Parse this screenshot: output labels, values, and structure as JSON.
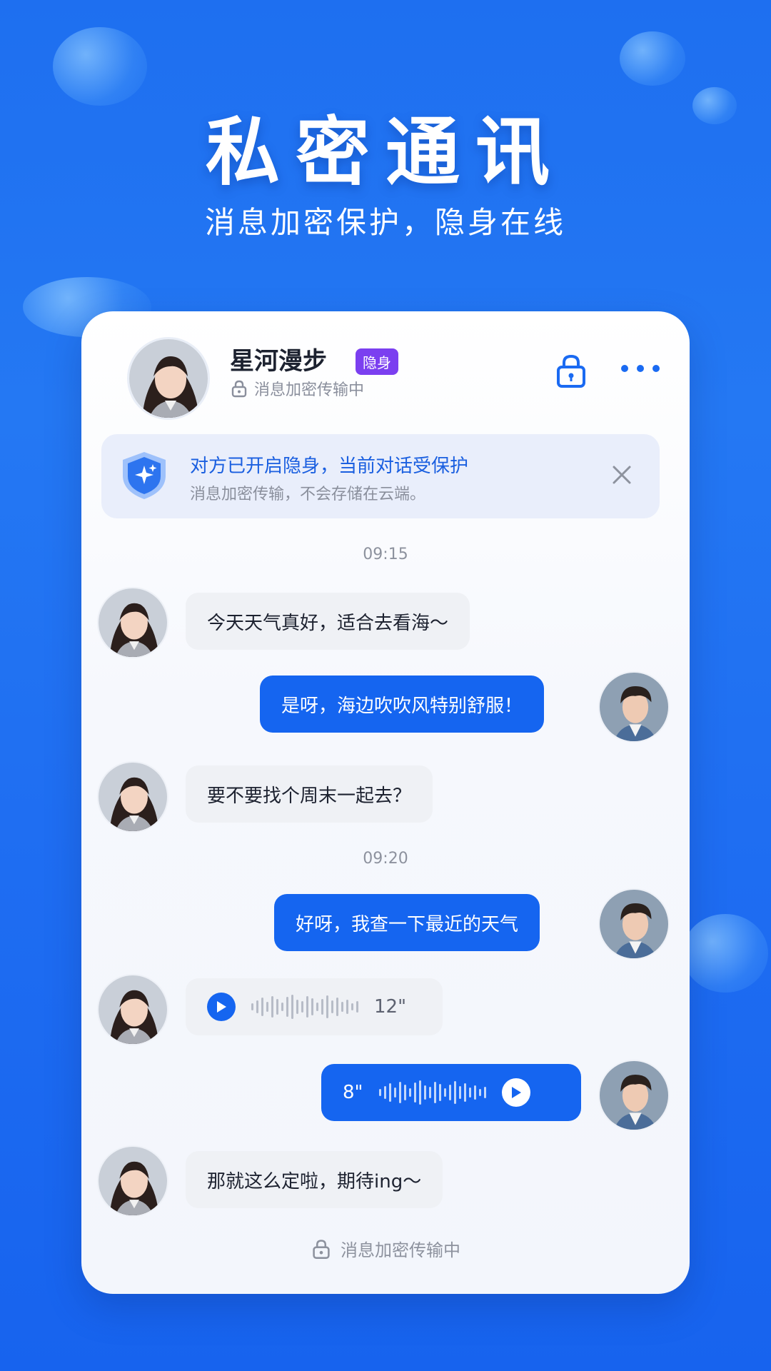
{
  "hero": {
    "title": "私密通讯",
    "subtitle": "消息加密保护，隐身在线"
  },
  "header": {
    "contact_name": "星河漫步",
    "badge": "隐身",
    "status": "消息加密传输中",
    "lock_icon": "lock-icon",
    "more_icon": "more-dots-icon"
  },
  "notice": {
    "title": "对方已开启隐身，当前对话受保护",
    "description": "消息加密传输，不会存储在云端。",
    "icon": "shield-icon",
    "close_icon": "close-icon"
  },
  "chat": {
    "time_1": "09:15",
    "time_2": "09:20",
    "messages": [
      {
        "side": "in",
        "text": "今天天气真好，适合去看海～"
      },
      {
        "side": "out",
        "text": "是呀，海边吹吹风特别舒服！"
      },
      {
        "side": "in",
        "text": "要不要找个周末一起去？"
      },
      {
        "side": "out",
        "text": "好呀，我查一下最近的天气"
      },
      {
        "side": "in",
        "type": "voice",
        "duration": "12\""
      },
      {
        "side": "out",
        "type": "voice",
        "duration": "8\""
      },
      {
        "side": "in",
        "text": "那就这么定啦，期待ing～"
      }
    ]
  },
  "footer": {
    "text": "消息加密传输中"
  },
  "colors": {
    "accent": "#1565f0",
    "badge": "#7b3ff0",
    "background": "#1e6ff0"
  }
}
